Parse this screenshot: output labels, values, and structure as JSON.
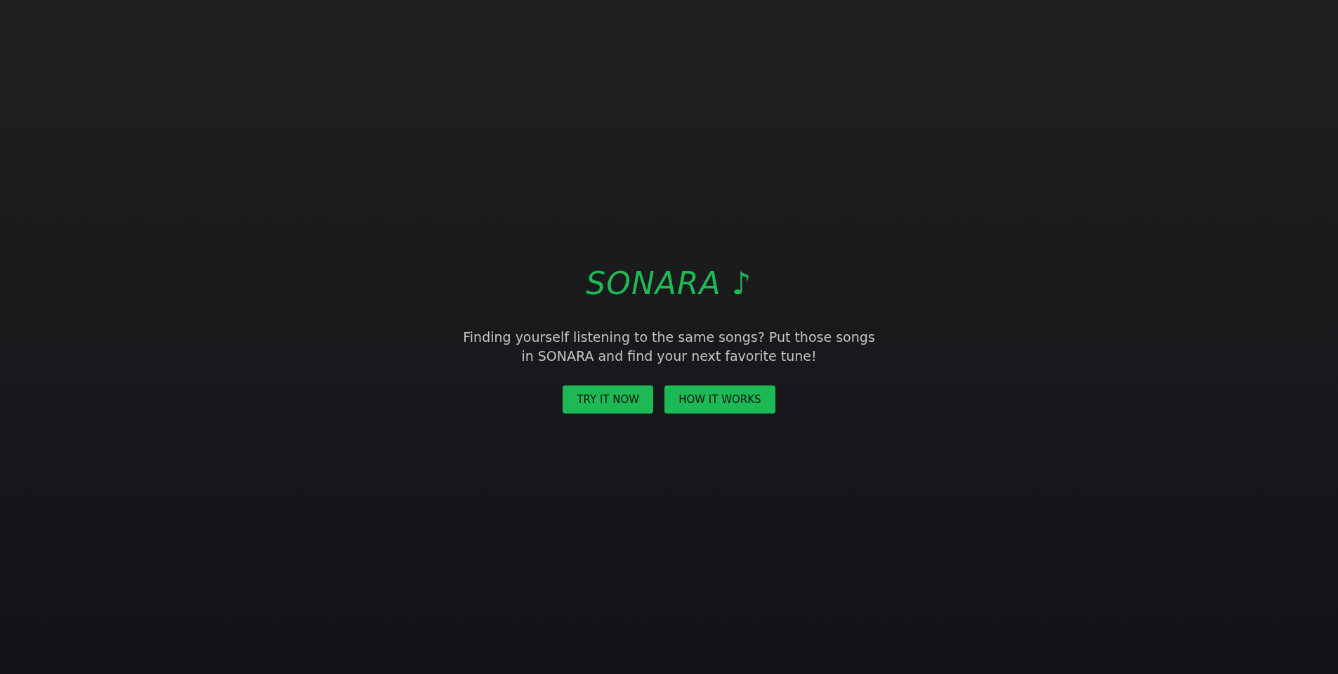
{
  "hero": {
    "title": "SONARA ♪",
    "tagline": "Finding yourself listening to the same songs? Put those songs in SONARA and find your next favorite tune!",
    "buttons": [
      "TRY IT NOW",
      "HOW IT WORKS"
    ]
  }
}
